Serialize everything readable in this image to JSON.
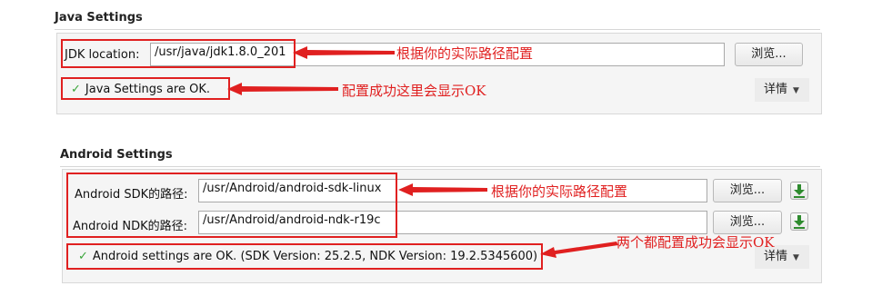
{
  "java": {
    "title": "Java Settings",
    "jdk_label": "JDK location:",
    "jdk_value": "/usr/java/jdk1.8.0_201",
    "browse": "浏览...",
    "status": "Java Settings are OK.",
    "details": "详情",
    "annotation_path": "根据你的实际路径配置",
    "annotation_ok": "配置成功这里会显示OK"
  },
  "android": {
    "title": "Android Settings",
    "sdk_label": "Android SDK的路径:",
    "sdk_value": "/usr/Android/android-sdk-linux",
    "ndk_label": "Android NDK的路径:",
    "ndk_value": "/usr/Android/android-ndk-r19c",
    "browse": "浏览...",
    "status": "Android settings are OK. (SDK Version: 25.2.5, NDK Version: 19.2.5345600)",
    "details": "详情",
    "annotation_path": "根据你的实际路径配置",
    "annotation_ok": "两个都配置成功会显示OK"
  },
  "colors": {
    "annotation": "#e02020",
    "check": "#39a539",
    "download": "#2e8b2e"
  },
  "icons": [
    "check-icon",
    "download-icon",
    "chevron-down-icon",
    "arrow-left-icon"
  ]
}
